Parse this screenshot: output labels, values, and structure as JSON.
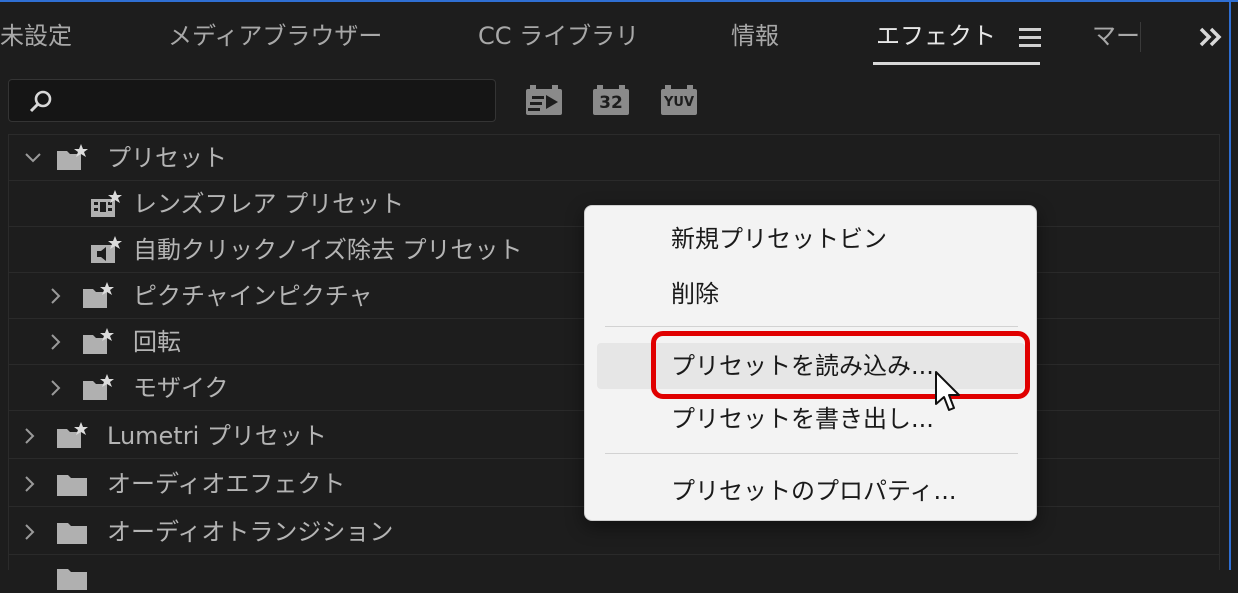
{
  "tabs": [
    {
      "label": "未設定",
      "active": false
    },
    {
      "label": "メディアブラウザー",
      "active": false
    },
    {
      "label": "CC ライブラリ",
      "active": false
    },
    {
      "label": "情報",
      "active": false
    },
    {
      "label": "エフェクト",
      "active": true
    },
    {
      "label": "マー",
      "active": false
    }
  ],
  "search": {
    "value": "",
    "placeholder": ""
  },
  "filters": [
    {
      "icon": "accelerated-effects-icon"
    },
    {
      "icon": "32-bit-color-icon",
      "text": "32"
    },
    {
      "icon": "yuv-effects-icon",
      "text": "YUV"
    }
  ],
  "tree": [
    {
      "label": "プリセット",
      "expanded": true,
      "icon": "preset-folder-icon"
    },
    {
      "label": "レンズフレア プリセット",
      "icon": "video-preset-icon"
    },
    {
      "label": "自動クリックノイズ除去 プリセット",
      "icon": "audio-preset-icon"
    },
    {
      "label": "ピクチャインピクチャ",
      "expanded": false,
      "icon": "preset-folder-icon"
    },
    {
      "label": "回転",
      "expanded": false,
      "icon": "preset-folder-icon"
    },
    {
      "label": "モザイク",
      "expanded": false,
      "icon": "preset-folder-icon"
    },
    {
      "label": "Lumetri プリセット",
      "expanded": false,
      "icon": "preset-folder-icon"
    },
    {
      "label": "オーディオエフェクト",
      "expanded": false,
      "icon": "folder-icon"
    },
    {
      "label": "オーディオトランジション",
      "expanded": false,
      "icon": "folder-icon"
    }
  ],
  "context_menu": {
    "items": [
      {
        "label": "新規プリセットビン"
      },
      {
        "label": "削除"
      },
      {
        "label": "プリセットを読み込み..."
      },
      {
        "label": "プリセットを書き出し..."
      },
      {
        "label": "プリセットのプロパティ..."
      }
    ]
  },
  "colors": {
    "highlight": "#e00000",
    "panel_border": "#2f6fd3",
    "menu_bg": "#f3f3f3"
  }
}
